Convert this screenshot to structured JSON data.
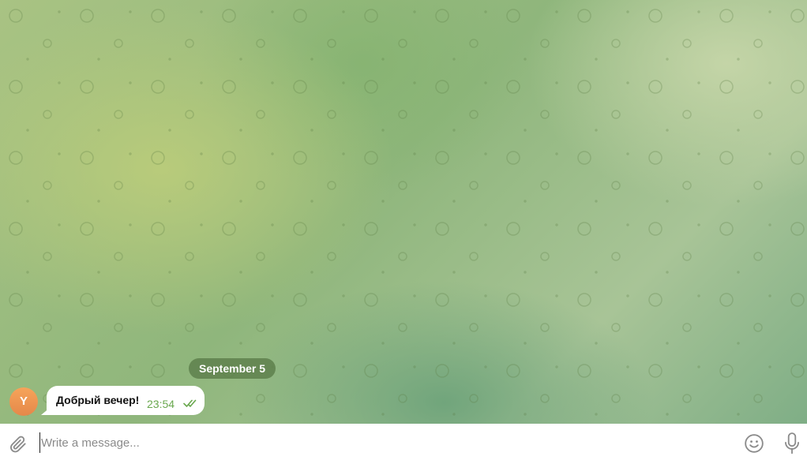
{
  "chat": {
    "date_separator": "September 5",
    "messages": [
      {
        "avatar_initial": "Y",
        "text": "Добрый вечер!",
        "time": "23:54",
        "status_icon": "double-check-icon"
      }
    ]
  },
  "composer": {
    "placeholder": "Write a message...",
    "value": "",
    "icons": [
      "paperclip-icon",
      "emoji-icon",
      "microphone-icon"
    ]
  },
  "colors": {
    "time_accent": "#6aa84f",
    "avatar": "#ef9650",
    "date_pill": "#5e804c"
  }
}
